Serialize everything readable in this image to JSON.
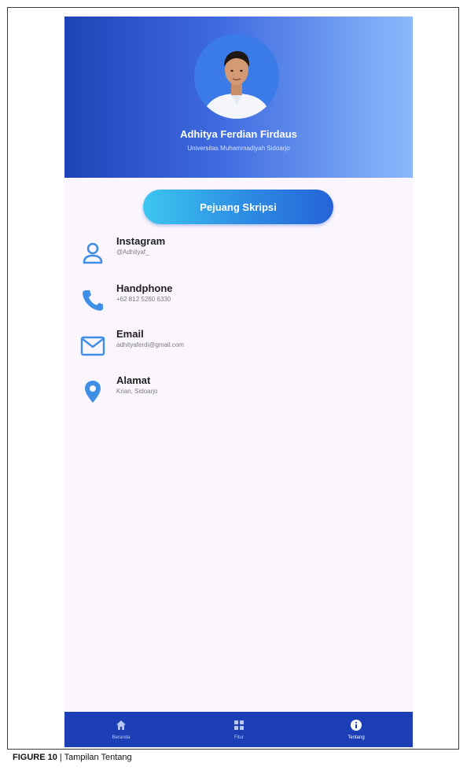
{
  "profile": {
    "name": "Adhitya Ferdian Firdaus",
    "university": "Universitas Muhammadiyah Sidoarjo"
  },
  "badge_label": "Pejuang Skripsi",
  "contacts": [
    {
      "icon": "person-icon",
      "title": "Instagram",
      "value": "@Adhityaf_"
    },
    {
      "icon": "phone-icon",
      "title": "Handphone",
      "value": "+62 812 5260 6330"
    },
    {
      "icon": "mail-icon",
      "title": "Email",
      "value": "adhityaferdi@gmail.com"
    },
    {
      "icon": "location-pin-icon",
      "title": "Alamat",
      "value": "Krian, Sidoarjo"
    }
  ],
  "nav": [
    {
      "icon": "home-icon",
      "label": "Beranda"
    },
    {
      "icon": "grid-icon",
      "label": "Fitur"
    },
    {
      "icon": "info-icon",
      "label": "Tentang"
    }
  ],
  "caption": {
    "figure": "FIGURE 10",
    "separator": " | ",
    "text": "Tampilan Tentang"
  },
  "colors": {
    "header_start": "#1e43b6",
    "header_end": "#8bb9fb",
    "accent": "#2d8be3",
    "icon": "#3f8fe6",
    "nav_bg": "#1d3fb5"
  }
}
